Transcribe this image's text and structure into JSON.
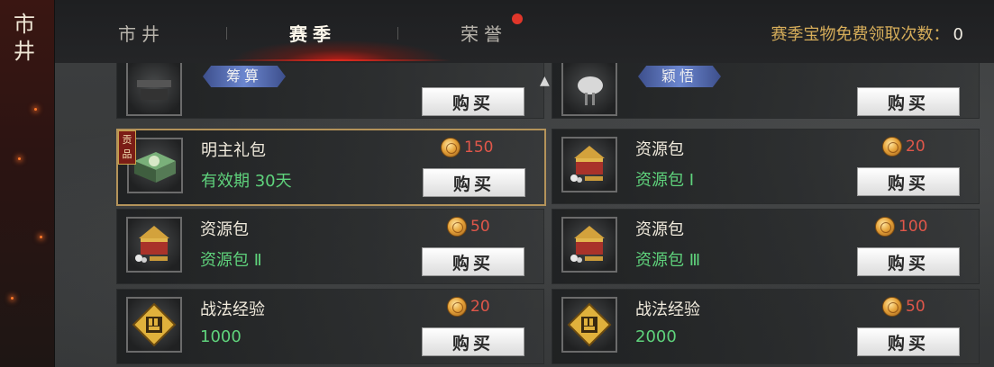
{
  "sidebar": {
    "title": "市井"
  },
  "tabs": [
    {
      "label": "市井"
    },
    {
      "label": "赛季"
    },
    {
      "label": "荣誉"
    }
  ],
  "header": {
    "free_claim_label": "赛季宝物免费领取次数：",
    "free_claim_count": "0"
  },
  "partial_row": {
    "left": {
      "ribbon": "筹算",
      "buy_label": "购买"
    },
    "right": {
      "ribbon": "颖悟",
      "buy_label": "购买"
    }
  },
  "items": [
    {
      "name": "明主礼包",
      "sub": "有效期 30天",
      "price": "150",
      "buy_label": "购买",
      "badge": "贡品",
      "icon": "gift-box-icon"
    },
    {
      "name": "资源包",
      "sub": "资源包 Ⅰ",
      "price": "20",
      "buy_label": "购买",
      "icon": "resource-chest-icon"
    },
    {
      "name": "资源包",
      "sub": "资源包 Ⅱ",
      "price": "50",
      "buy_label": "购买",
      "icon": "resource-chest-icon"
    },
    {
      "name": "资源包",
      "sub": "资源包 Ⅲ",
      "price": "100",
      "buy_label": "购买",
      "icon": "resource-chest-icon"
    },
    {
      "name": "战法经验",
      "sub": "1000",
      "price": "20",
      "buy_label": "购买",
      "icon": "tactic-exp-icon"
    },
    {
      "name": "战法经验",
      "sub": "2000",
      "price": "50",
      "buy_label": "购买",
      "icon": "tactic-exp-icon"
    }
  ],
  "colors": {
    "accent_red": "#d82a1e",
    "price_red": "#e0574a",
    "sub_green": "#5fd37c",
    "free_label_gold": "#d6ad5a"
  }
}
